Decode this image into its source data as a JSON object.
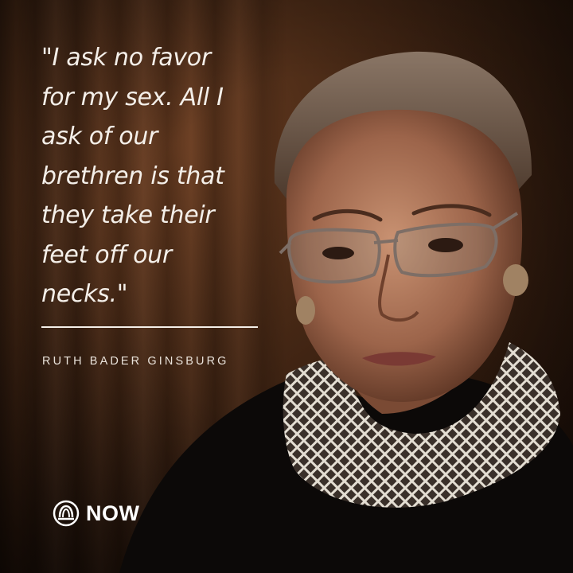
{
  "quote": {
    "text": "\"I ask no favor\nfor my sex. All I\nask of our\nbrethren is that\nthey take their\nfeet off our\nnecks.\""
  },
  "attribution": {
    "name": "RUTH BADER GINSBURG"
  },
  "logo": {
    "text": "NOW",
    "icon": "now-logo-icon"
  },
  "colors": {
    "text": "#f4efe9",
    "background": "#4a2a16",
    "robe": "#0c0908",
    "collar": "#e3ddd2"
  }
}
